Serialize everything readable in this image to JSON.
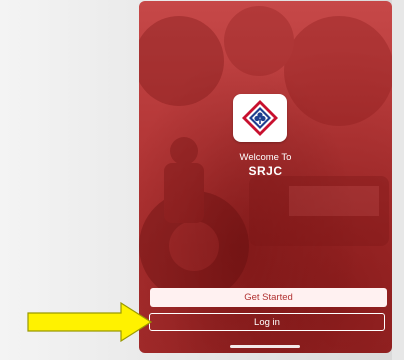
{
  "app": {
    "welcome_text": "Welcome To",
    "brand_name": "SRJC",
    "logo_icon": "srjc-logo-icon"
  },
  "buttons": {
    "get_started": "Get Started",
    "log_in": "Log in"
  },
  "annotation": {
    "arrow_icon": "yellow-arrow-icon",
    "arrow_color": "#fff200"
  },
  "colors": {
    "accent_red": "#b63939",
    "button_fill": "#fff1f1",
    "button_text": "#b13232"
  }
}
